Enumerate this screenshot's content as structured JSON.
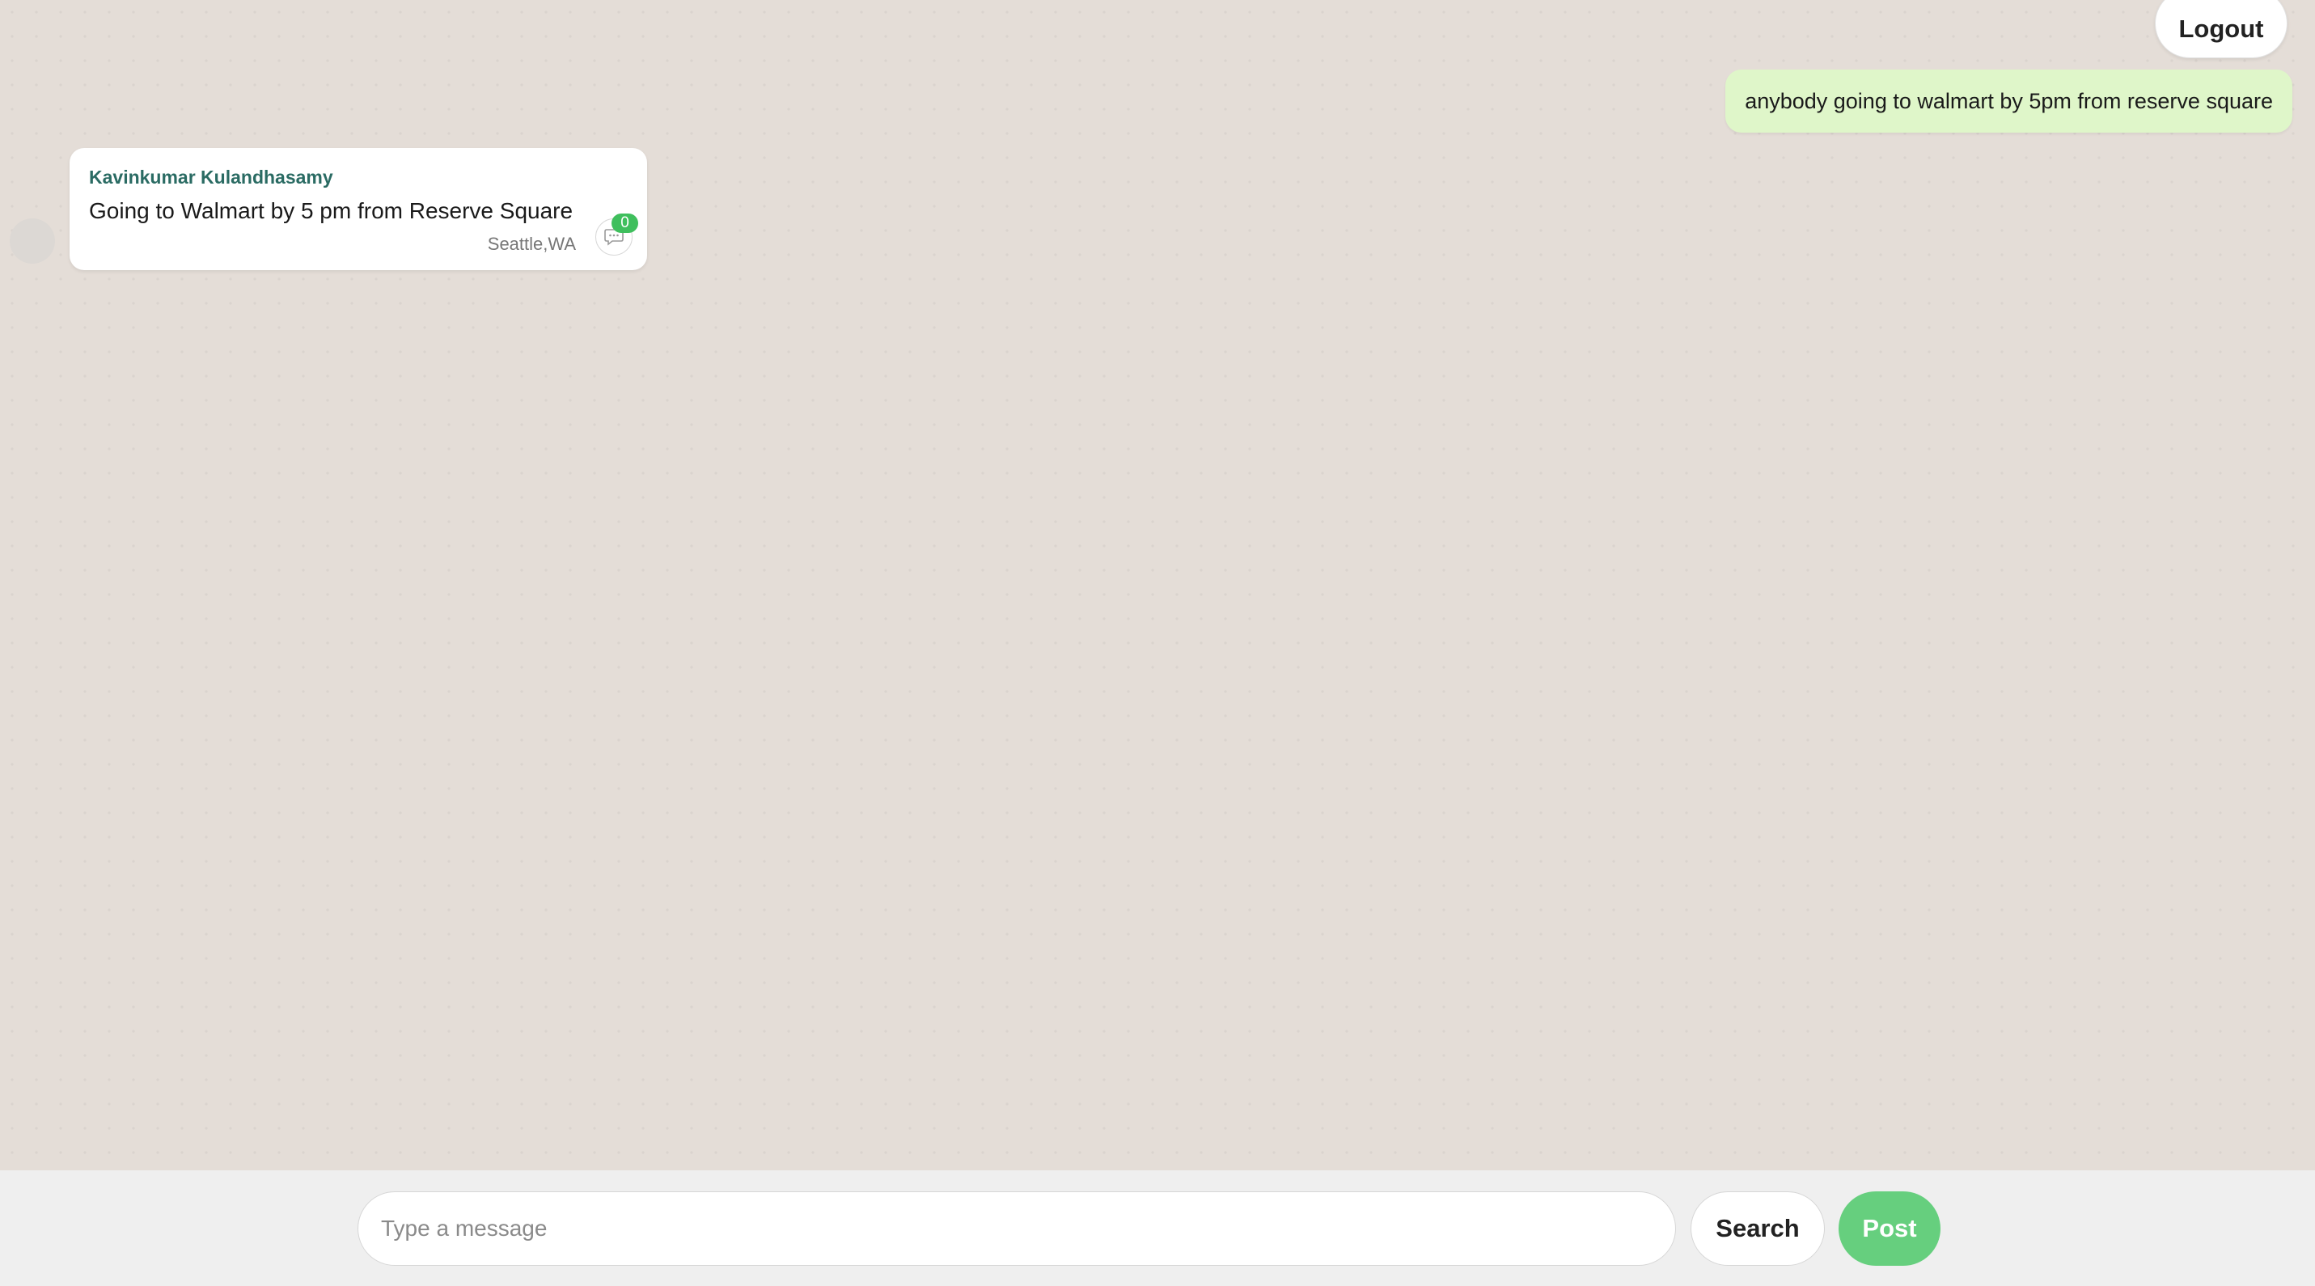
{
  "header": {
    "logout_label": "Logout"
  },
  "outgoing_message": {
    "text": "anybody going to walmart by 5pm from reserve square"
  },
  "incoming_message": {
    "sender": "Kavinkumar Kulandhasamy",
    "text": "Going to Walmart by 5 pm from Reserve Square",
    "location": "Seattle,WA",
    "comment_count": "0",
    "comment_icon": "chat-bubble-icon"
  },
  "composer": {
    "placeholder": "Type a message",
    "value": "",
    "search_label": "Search",
    "post_label": "Post"
  },
  "colors": {
    "background": "#e4ddd7",
    "outgoing_bubble": "#dff6c9",
    "sender_name": "#2a6b63",
    "badge": "#3fbf5d",
    "post_button": "#66cf7e"
  }
}
